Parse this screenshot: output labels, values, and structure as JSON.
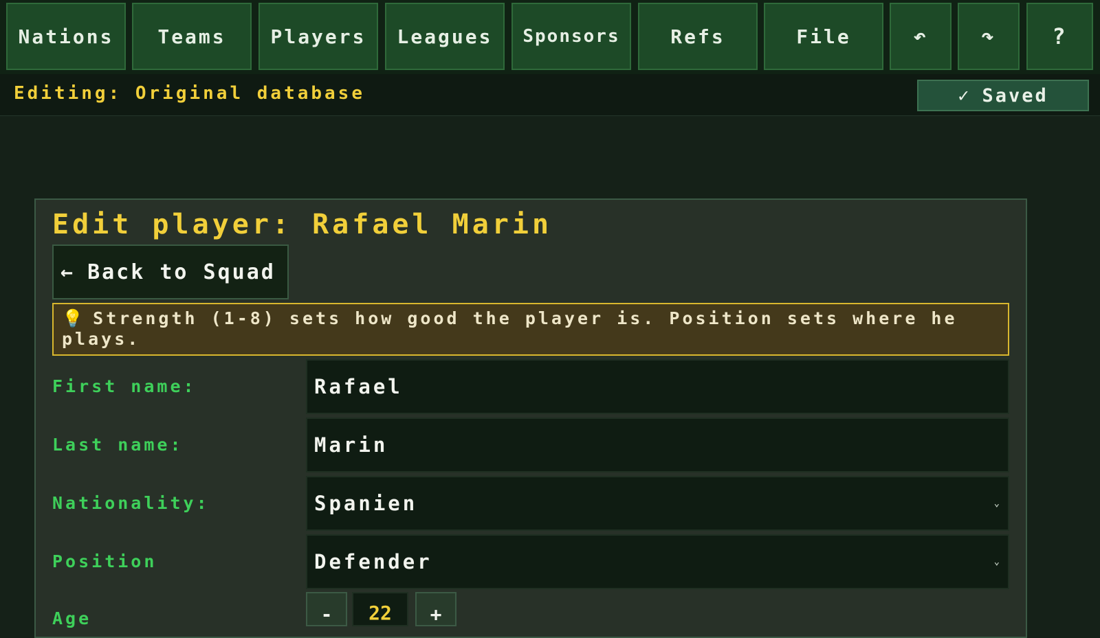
{
  "nav": {
    "nations": "Nations",
    "teams": "Teams",
    "players": "Players",
    "leagues": "Leagues",
    "sponsors": "Sponsors",
    "refs": "Refs",
    "file": "File",
    "undo_icon": "↶",
    "redo_icon": "↷",
    "help": "?"
  },
  "status": {
    "editing": "Editing: Original database",
    "saved_check": "✓",
    "saved_label": "Saved"
  },
  "editor": {
    "title": "Edit player: Rafael Marin",
    "back_arrow": "←",
    "back_label": "Back to Squad",
    "hint_icon": "💡",
    "hint_text": "Strength (1-8) sets how good the player is. Position sets where he plays.",
    "first_name_label": "First name:",
    "first_name_value": "Rafael",
    "last_name_label": "Last name:",
    "last_name_value": "Marin",
    "nationality_label": "Nationality:",
    "nationality_value": "Spanien",
    "position_label": "Position",
    "position_value": "Defender",
    "age_label": "Age",
    "age_minus": "-",
    "age_value": "22",
    "age_plus": "+"
  },
  "colors": {
    "accent_yellow": "#f1cf3a",
    "label_green": "#3ed05a",
    "nav_green": "#1d4a27"
  },
  "icons": {
    "undo": "undo-icon",
    "redo": "redo-icon",
    "help": "help-icon",
    "check": "check-icon",
    "back": "arrow-left-icon",
    "hint": "lightbulb-icon",
    "dropdown": "chevron-down-icon"
  }
}
